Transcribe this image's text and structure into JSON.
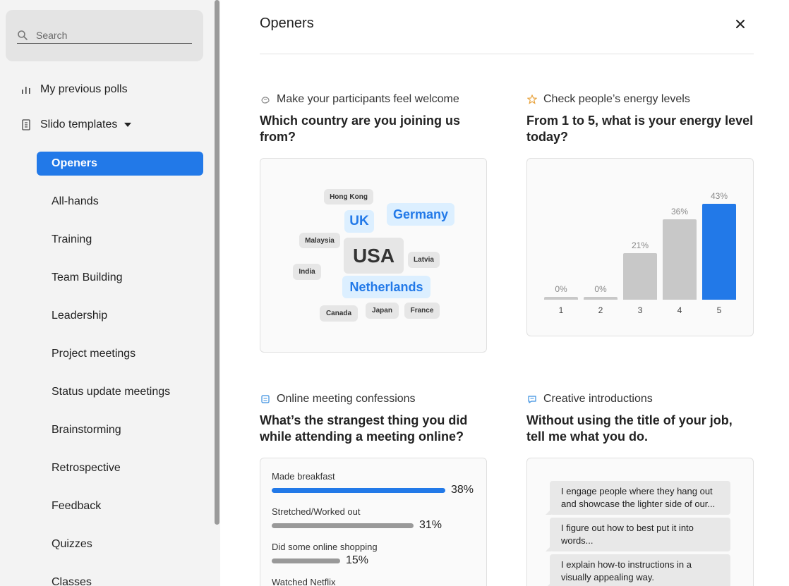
{
  "search": {
    "placeholder": "Search"
  },
  "nav": {
    "previous_polls": "My previous polls",
    "templates": "Slido templates",
    "items": [
      "Openers",
      "All-hands",
      "Training",
      "Team Building",
      "Leadership",
      "Project meetings",
      "Status update meetings",
      "Brainstorming",
      "Retrospective",
      "Feedback",
      "Quizzes",
      "Classes"
    ]
  },
  "page": {
    "title": "Openers"
  },
  "cards": {
    "welcome": {
      "category": "Make your participants feel welcome",
      "question": "Which country are you joining us from?",
      "words": [
        "Hong Kong",
        "UK",
        "Germany",
        "Malaysia",
        "USA",
        "Latvia",
        "India",
        "Netherlands",
        "Canada",
        "Japan",
        "France"
      ]
    },
    "energy": {
      "category": "Check people’s energy levels",
      "question": "From 1 to 5, what is your energy level today?"
    },
    "confessions": {
      "category": "Online meeting confessions",
      "question": "What’s the strangest thing you did while attending a meeting online?",
      "options": [
        {
          "label": "Made breakfast",
          "pct": "38%",
          "value": 38
        },
        {
          "label": "Stretched/Worked out",
          "pct": "31%",
          "value": 31
        },
        {
          "label": "Did some online shopping",
          "pct": "15%",
          "value": 15
        },
        {
          "label": "Watched Netflix",
          "pct": "",
          "value": 0
        }
      ]
    },
    "intros": {
      "category": "Creative introductions",
      "question": "Without using the title of your job, tell me what you do.",
      "answers": [
        "I engage people where they hang out and showcase the lighter side of our...",
        "I figure out how to best put it into words...",
        "I explain how-to instructions in a visually appealing way."
      ]
    }
  },
  "chart_data": {
    "type": "bar",
    "categories": [
      "1",
      "2",
      "3",
      "4",
      "5"
    ],
    "values": [
      0,
      0,
      21,
      36,
      43
    ],
    "value_labels": [
      "0%",
      "0%",
      "21%",
      "36%",
      "43%"
    ],
    "highlight_index": 4,
    "ylim": [
      0,
      43
    ]
  },
  "colors": {
    "accent": "#2279e8",
    "bar_gray": "#c8c8c8",
    "sidebar_bg": "#f3f3f3"
  }
}
